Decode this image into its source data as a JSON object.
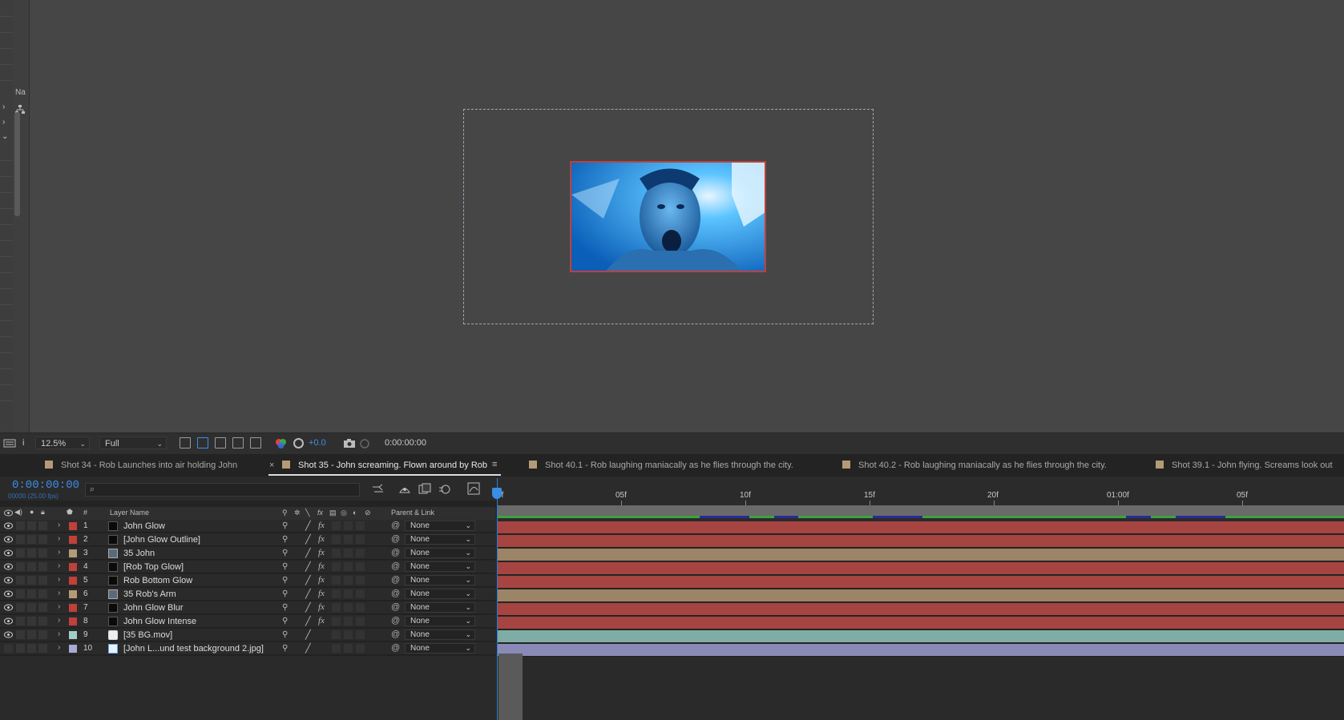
{
  "viewer": {
    "left_panel_label": "Na",
    "zoom": "12.5%",
    "resolution": "Full",
    "exposure": "+0.0",
    "timecode": "0:00:00:00"
  },
  "tabs": [
    {
      "label": "Shot 34 - Rob Launches into air holding John",
      "color": "#b49b77",
      "active": false
    },
    {
      "label": "Shot 35 - John screaming. Flown around by Rob",
      "color": "#b49b77",
      "active": true
    },
    {
      "label": "Shot 40.1 - Rob laughing maniacally as he flies through the city.",
      "color": "#b49b77",
      "active": false
    },
    {
      "label": "Shot 40.2 - Rob laughing maniacally as he flies through the city.",
      "color": "#b49b77",
      "active": false
    },
    {
      "label": "Shot 39.1 - John flying. Screams look out",
      "color": "#b49b77",
      "active": false
    }
  ],
  "timeline": {
    "current_time": "0:00:00:00",
    "fps_label": "00000 (25.00 fps)",
    "search_placeholder": "",
    "columns": {
      "number": "#",
      "layer_name": "Layer Name",
      "parent_link": "Parent & Link"
    },
    "ruler": [
      "0f",
      "05f",
      "10f",
      "15f",
      "20f",
      "01:00f",
      "05f"
    ],
    "layers": [
      {
        "num": "1",
        "name": "John Glow",
        "label_color": "#c0403a",
        "source": "solid",
        "parent": "None",
        "bar_color": "#a64442",
        "visible": true
      },
      {
        "num": "2",
        "name": "[John Glow Outline]",
        "label_color": "#c0403a",
        "source": "solid",
        "parent": "None",
        "bar_color": "#a64442",
        "visible": true
      },
      {
        "num": "3",
        "name": "35 John",
        "label_color": "#b49b77",
        "source": "comp",
        "parent": "None",
        "bar_color": "#9c8466",
        "visible": true
      },
      {
        "num": "4",
        "name": "[Rob Top Glow]",
        "label_color": "#c0403a",
        "source": "solid",
        "parent": "None",
        "bar_color": "#a64442",
        "visible": true
      },
      {
        "num": "5",
        "name": "Rob Bottom Glow",
        "label_color": "#c0403a",
        "source": "solid",
        "parent": "None",
        "bar_color": "#a64442",
        "visible": true
      },
      {
        "num": "6",
        "name": "35 Rob's Arm",
        "label_color": "#b49b77",
        "source": "comp",
        "parent": "None",
        "bar_color": "#9c8466",
        "visible": true
      },
      {
        "num": "7",
        "name": "John Glow Blur",
        "label_color": "#c0403a",
        "source": "solid",
        "parent": "None",
        "bar_color": "#a64442",
        "visible": true
      },
      {
        "num": "8",
        "name": "John Glow Intense",
        "label_color": "#c0403a",
        "source": "solid",
        "parent": "None",
        "bar_color": "#a64442",
        "visible": true
      },
      {
        "num": "9",
        "name": "[35 BG.mov]",
        "label_color": "#9fd0c7",
        "source": "movie",
        "parent": "None",
        "bar_color": "#7fada5",
        "visible": true
      },
      {
        "num": "10",
        "name": "[John L...und test background 2.jpg]",
        "label_color": "#a9a9d6",
        "source": "image",
        "parent": "None",
        "bar_color": "#8a8ab8",
        "visible": false
      }
    ]
  }
}
